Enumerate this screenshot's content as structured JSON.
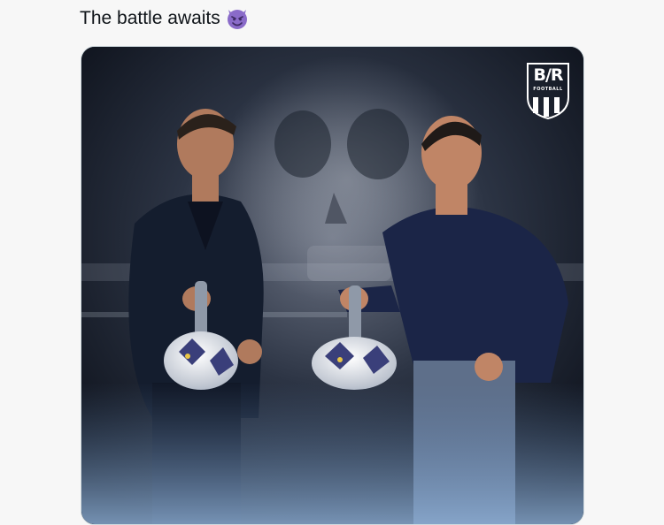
{
  "tweet": {
    "text": "The battle awaits",
    "emoji": "smiling-devil-emoji"
  },
  "media": {
    "logo_main": "B/R",
    "logo_sub": "FOOTBALL"
  },
  "colors": {
    "text": "#0f1419",
    "emoji_purple": "#8a6bc9",
    "media_bg": "#0e1420"
  }
}
